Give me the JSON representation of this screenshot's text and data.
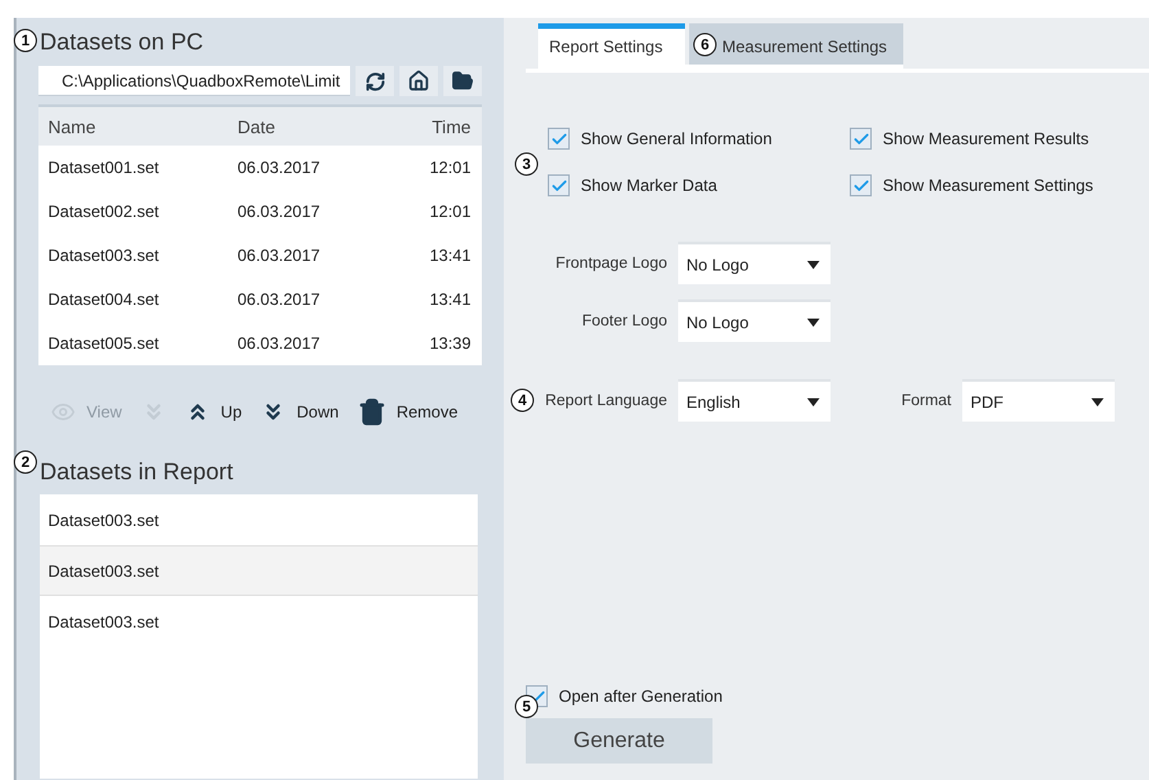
{
  "datasets_on_pc": {
    "title": "Datasets on PC",
    "path": "C:\\Applications\\QuadboxRemote\\Limit",
    "table": {
      "columns": [
        "Name",
        "Date",
        "Time"
      ],
      "rows": [
        [
          "Dataset001.set",
          "06.03.2017",
          "12:01"
        ],
        [
          "Dataset002.set",
          "06.03.2017",
          "12:01"
        ],
        [
          "Dataset003.set",
          "06.03.2017",
          "13:41"
        ],
        [
          "Dataset004.set",
          "06.03.2017",
          "13:41"
        ],
        [
          "Dataset005.set",
          "06.03.2017",
          "13:39"
        ]
      ]
    },
    "actions": [
      {
        "kind": "view",
        "label": "View",
        "disabled": true
      },
      {
        "kind": "add",
        "disabled": true
      },
      {
        "kind": "up",
        "label": "Up",
        "disabled": false
      },
      {
        "kind": "down",
        "label": "Down",
        "disabled": false
      },
      {
        "kind": "remove",
        "label": "Remove",
        "disabled": false
      }
    ]
  },
  "datasets_in_report": {
    "title": "Datasets in Report",
    "items": [
      {
        "label": "Dataset003.set",
        "selected": false
      },
      {
        "label": "Dataset003.set",
        "selected": true
      },
      {
        "label": "Dataset003.set",
        "selected": false
      }
    ]
  },
  "tabs": [
    {
      "label": "Report Settings",
      "selected": true
    },
    {
      "label": "Measurement Settings",
      "selected": false
    }
  ],
  "options": [
    {
      "label": "Show General Information",
      "checked": true
    },
    {
      "label": "Show Measurement Results",
      "checked": true
    },
    {
      "label": "Show Marker Data",
      "checked": true
    },
    {
      "label": "Show Measurement Settings",
      "checked": true
    }
  ],
  "frontpage_logo": {
    "label": "Frontpage Logo",
    "value": "No Logo"
  },
  "footer_logo": {
    "label": "Footer Logo",
    "value": "No Logo"
  },
  "report_language": {
    "label": "Report Language",
    "value": "English"
  },
  "format": {
    "label": "Format",
    "value": "PDF"
  },
  "open_after_generation": {
    "label": "Open after Generation",
    "checked": true
  },
  "generate_button": "Generate",
  "callouts": [
    "1",
    "2",
    "3",
    "4",
    "5",
    "6"
  ]
}
